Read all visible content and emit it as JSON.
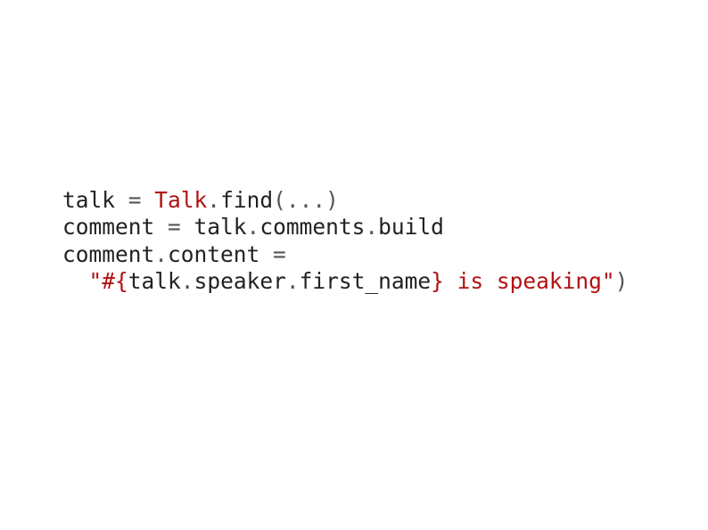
{
  "colors": {
    "default": "#222222",
    "constant": "#b11212",
    "punct": "#555555",
    "string": "#b11212"
  },
  "code": {
    "tokens": [
      {
        "t": "talk ",
        "c": "default"
      },
      {
        "t": "= ",
        "c": "punct"
      },
      {
        "t": "Talk",
        "c": "constant"
      },
      {
        "t": ".",
        "c": "punct"
      },
      {
        "t": "find",
        "c": "default"
      },
      {
        "t": "(...)",
        "c": "punct"
      },
      {
        "t": "\n",
        "c": "default"
      },
      {
        "t": "comment ",
        "c": "default"
      },
      {
        "t": "= ",
        "c": "punct"
      },
      {
        "t": "talk",
        "c": "default"
      },
      {
        "t": ".",
        "c": "punct"
      },
      {
        "t": "comments",
        "c": "default"
      },
      {
        "t": ".",
        "c": "punct"
      },
      {
        "t": "build",
        "c": "default"
      },
      {
        "t": "\n",
        "c": "default"
      },
      {
        "t": "comment",
        "c": "default"
      },
      {
        "t": ".",
        "c": "punct"
      },
      {
        "t": "content ",
        "c": "default"
      },
      {
        "t": "=",
        "c": "punct"
      },
      {
        "t": "\n",
        "c": "default"
      },
      {
        "t": "  ",
        "c": "default"
      },
      {
        "t": "\"#{",
        "c": "string"
      },
      {
        "t": "talk",
        "c": "default"
      },
      {
        "t": ".",
        "c": "punct"
      },
      {
        "t": "speaker",
        "c": "default"
      },
      {
        "t": ".",
        "c": "punct"
      },
      {
        "t": "first_name",
        "c": "default"
      },
      {
        "t": "}",
        "c": "string"
      },
      {
        "t": " is speaking\"",
        "c": "string"
      },
      {
        "t": ")",
        "c": "punct"
      }
    ]
  }
}
